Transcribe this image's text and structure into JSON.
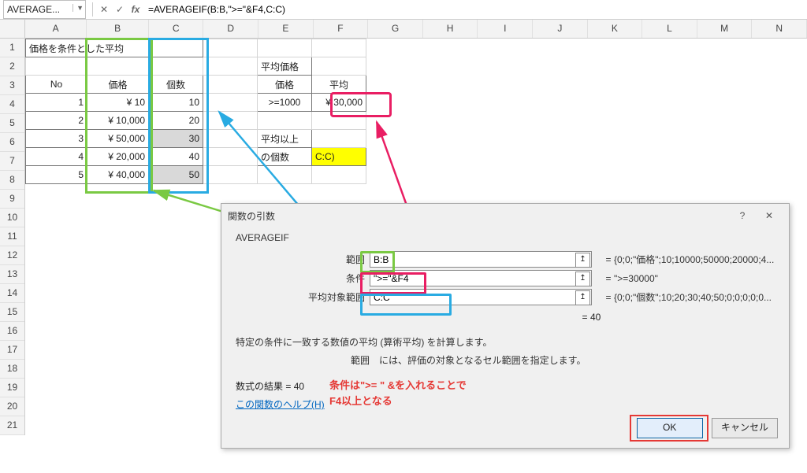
{
  "formula_bar": {
    "name_box": "AVERAGE...",
    "formula": "=AVERAGEIF(B:B,\">=\"&F4,C:C)"
  },
  "columns": [
    "A",
    "B",
    "C",
    "D",
    "E",
    "F",
    "G",
    "H",
    "I",
    "J",
    "K",
    "L",
    "M",
    "N"
  ],
  "row_nums": [
    1,
    2,
    3,
    4,
    5,
    6,
    7,
    8,
    9,
    10,
    11,
    12,
    13,
    14,
    15,
    16,
    17,
    18,
    19,
    20,
    21
  ],
  "sheet": {
    "a1": "価格を条件とした平均",
    "hdr_no": "No",
    "hdr_price": "価格",
    "hdr_qty": "個数",
    "rows": [
      {
        "no": "1",
        "price": "¥      10",
        "qty": "10"
      },
      {
        "no": "2",
        "price": "¥ 10,000",
        "qty": "20"
      },
      {
        "no": "3",
        "price": "¥ 50,000",
        "qty": "30"
      },
      {
        "no": "4",
        "price": "¥ 20,000",
        "qty": "40"
      },
      {
        "no": "5",
        "price": "¥ 40,000",
        "qty": "50"
      }
    ],
    "avg_title": "平均価格",
    "avg_price_hdr": "価格",
    "avg_avg_hdr": "平均",
    "avg_cond": ">=1000",
    "avg_val": "¥ 30,000",
    "over_title": "平均以上",
    "over_qty_lbl": "の個数",
    "over_val": "C:C)"
  },
  "dialog": {
    "title": "関数の引数",
    "help_icon": "?",
    "close_icon": "✕",
    "fn": "AVERAGEIF",
    "args": {
      "range_lbl": "範囲",
      "range_val": "B:B",
      "range_res": "{0;0;\"価格\";10;10000;50000;20000;4...",
      "crit_lbl": "条件",
      "crit_val": "\">=\"&F4",
      "crit_res": "\">=30000\"",
      "avg_lbl": "平均対象範囲",
      "avg_val": "C:C",
      "avg_res": "{0;0;\"個数\";10;20;30;40;50;0;0;0;0;0..."
    },
    "result_preview": "40",
    "desc": "特定の条件に一致する数値の平均 (算術平均) を計算します。",
    "desc2": "範囲　には、評価の対象となるセル範囲を指定します。",
    "final_lbl": "数式の結果 =  ",
    "final_val": "40",
    "help": "この関数のヘルプ(H)",
    "ok": "OK",
    "cancel": "キャンセル"
  },
  "note": "条件は\">= \" &を入れることで\nF4以上となる",
  "chart_data": {
    "type": "table",
    "title": "価格を条件とした平均",
    "columns": [
      "No",
      "価格",
      "個数"
    ],
    "rows": [
      [
        1,
        10,
        10
      ],
      [
        2,
        10000,
        20
      ],
      [
        3,
        50000,
        30
      ],
      [
        4,
        20000,
        40
      ],
      [
        5,
        40000,
        50
      ]
    ],
    "derived": {
      "平均価格_条件": ">=1000",
      "平均価格_平均": 30000,
      "平均以上の個数_式": "AVERAGEIF(B:B,\">=\"&F4,C:C)",
      "平均以上の個数_結果": 40
    }
  }
}
